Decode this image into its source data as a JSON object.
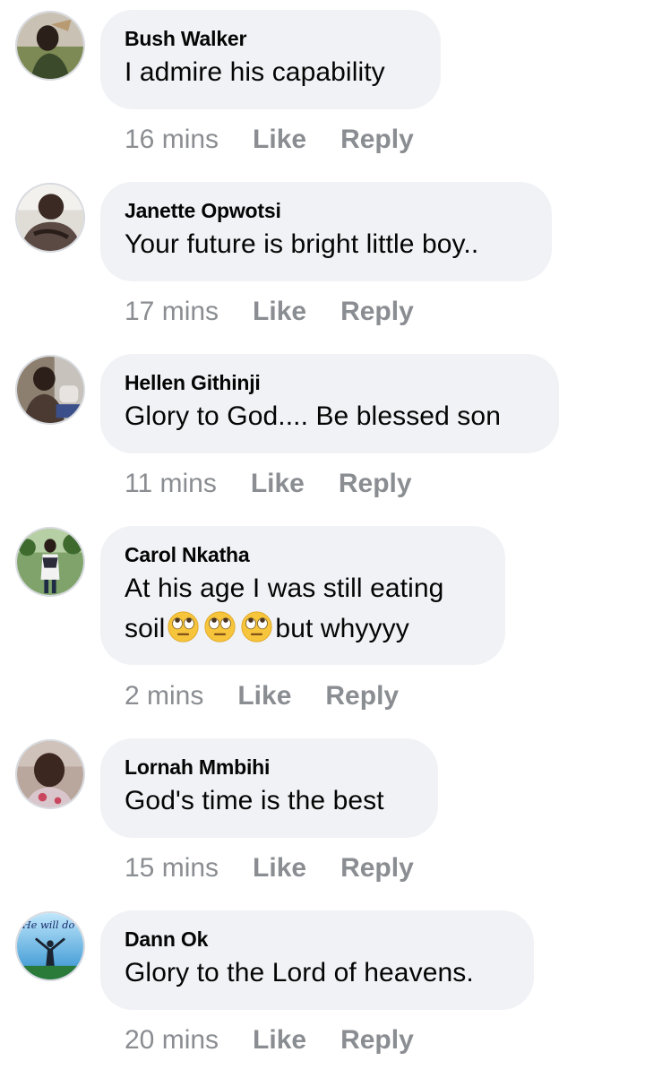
{
  "comments": [
    {
      "author": "Bush Walker",
      "text_lines": [
        "I admire his capability"
      ],
      "time": "16 mins",
      "like_label": "Like",
      "reply_label": "Reply",
      "avatar_color": "#7d8a55"
    },
    {
      "author": "Janette Opwotsi",
      "text_lines": [
        "Your future is bright little boy.."
      ],
      "time": "17 mins",
      "like_label": "Like",
      "reply_label": "Reply",
      "avatar_color": "#5b4a44"
    },
    {
      "author": "Hellen Githinji",
      "text_lines": [
        "Glory to God.... Be blessed son"
      ],
      "time": "11 mins",
      "like_label": "Like",
      "reply_label": "Reply",
      "avatar_color": "#4a3a32"
    },
    {
      "author": "Carol Nkatha",
      "text_lines": [
        "At his age I was still eating",
        "soil",
        "but whyyyy"
      ],
      "emojis": [
        "face-with-rolling-eyes-icon",
        "face-with-rolling-eyes-icon",
        "face-with-rolling-eyes-icon"
      ],
      "time": "2 mins",
      "like_label": "Like",
      "reply_label": "Reply",
      "avatar_color": "#4f7d3a"
    },
    {
      "author": "Lornah Mmbihi",
      "text_lines": [
        "God's time is the best"
      ],
      "time": "15 mins",
      "like_label": "Like",
      "reply_label": "Reply",
      "avatar_color": "#a07c6e"
    },
    {
      "author": "Dann Ok",
      "text_lines": [
        "Glory to the Lord of heavens."
      ],
      "time": "20 mins",
      "like_label": "Like",
      "reply_label": "Reply",
      "avatar_color": "#3fa3d9",
      "avatar_text": "He will do"
    }
  ],
  "colors": {
    "bubble": "#f0f2f5",
    "text": "#050505",
    "meta": "#8a8d91"
  }
}
